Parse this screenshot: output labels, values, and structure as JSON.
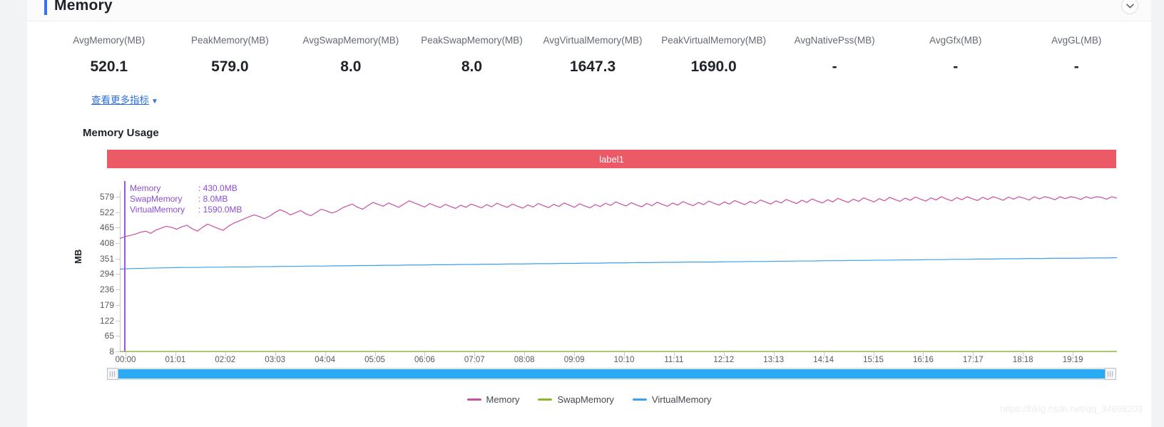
{
  "panel": {
    "title": "Memory",
    "collapse_icon": "chevron-down-icon"
  },
  "metrics": [
    {
      "label": "AvgMemory(MB)",
      "value": "520.1"
    },
    {
      "label": "PeakMemory(MB)",
      "value": "579.0"
    },
    {
      "label": "AvgSwapMemory(MB)",
      "value": "8.0"
    },
    {
      "label": "PeakSwapMemory(MB)",
      "value": "8.0"
    },
    {
      "label": "AvgVirtualMemory(MB)",
      "value": "1647.3"
    },
    {
      "label": "PeakVirtualMemory(MB)",
      "value": "1690.0"
    },
    {
      "label": "AvgNativePss(MB)",
      "value": "-"
    },
    {
      "label": "AvgGfx(MB)",
      "value": "-"
    },
    {
      "label": "AvgGL(MB)",
      "value": "-"
    }
  ],
  "more_link": {
    "label": "查看更多指标",
    "caret": "▼"
  },
  "chart_section": {
    "heading": "Memory Usage",
    "label_bar": {
      "text": "label1",
      "color": "#ec5a68"
    }
  },
  "tooltip": {
    "rows": [
      {
        "key": "Memory",
        "value": ": 430.0MB"
      },
      {
        "key": "SwapMemory",
        "value": ": 8.0MB"
      },
      {
        "key": "VirtualMemory",
        "value": ": 1590.0MB"
      }
    ],
    "color": "#8a4fd0"
  },
  "datazoom": {
    "left_handle_glyph": "|||",
    "right_handle_glyph": "|||",
    "fill_color": "#2cabf5"
  },
  "watermark": "https://blog.csdn.net/qq_34696203",
  "chart_data": {
    "type": "line",
    "title": "Memory Usage",
    "xlabel": "",
    "ylabel": "MB",
    "grid": false,
    "legend_position": "bottom",
    "ylim": [
      8,
      600
    ],
    "yticks": [
      579,
      522,
      465,
      408,
      351,
      294,
      236,
      179,
      122,
      65,
      8
    ],
    "x": [
      "00:00",
      "01:01",
      "02:02",
      "03:03",
      "04:04",
      "05:05",
      "06:06",
      "07:07",
      "08:08",
      "09:09",
      "10:10",
      "11:11",
      "12:12",
      "13:13",
      "14:14",
      "15:15",
      "16:16",
      "17:17",
      "18:18",
      "19:19"
    ],
    "xticks": [
      "00:00",
      "01:01",
      "02:02",
      "03:03",
      "04:04",
      "05:05",
      "06:06",
      "07:07",
      "08:08",
      "09:09",
      "10:10",
      "11:11",
      "12:12",
      "13:13",
      "14:14",
      "15:15",
      "16:16",
      "17:17",
      "18:18",
      "19:19"
    ],
    "series": [
      {
        "name": "Memory",
        "color": "#c94fa0",
        "unit": "MB",
        "values": [
          425,
          432,
          436,
          441,
          448,
          452,
          444,
          456,
          463,
          470,
          466,
          459,
          468,
          474,
          461,
          452,
          466,
          478,
          470,
          462,
          455,
          470,
          481,
          489,
          497,
          505,
          512,
          506,
          498,
          508,
          520,
          531,
          524,
          512,
          520,
          528,
          516,
          509,
          521,
          533,
          527,
          519,
          525,
          537,
          545,
          552,
          540,
          533,
          546,
          558,
          551,
          544,
          556,
          548,
          540,
          552,
          564,
          556,
          549,
          541,
          554,
          546,
          539,
          551,
          543,
          536,
          548,
          540,
          552,
          545,
          538,
          550,
          542,
          555,
          547,
          540,
          552,
          544,
          537,
          549,
          541,
          554,
          546,
          539,
          551,
          543,
          556,
          548,
          540,
          553,
          545,
          538,
          550,
          543,
          555,
          547,
          560,
          552,
          545,
          557,
          549,
          542,
          554,
          546,
          559,
          551,
          544,
          556,
          548,
          561,
          553,
          546,
          558,
          550,
          563,
          555,
          548,
          560,
          552,
          565,
          557,
          550,
          562,
          554,
          567,
          559,
          552,
          564,
          556,
          569,
          561,
          554,
          566,
          558,
          571,
          563,
          556,
          568,
          560,
          573,
          565,
          558,
          570,
          562,
          575,
          567,
          560,
          572,
          564,
          577,
          569,
          562,
          574,
          566,
          578,
          570,
          563,
          575,
          567,
          579,
          571,
          564,
          576,
          568,
          579,
          572,
          565,
          577,
          569,
          579,
          573,
          566,
          578,
          570,
          579,
          574,
          567,
          579,
          571,
          579,
          575,
          568,
          579,
          572,
          579,
          576,
          569,
          579,
          573,
          579,
          577,
          570,
          579,
          574
        ]
      },
      {
        "name": "SwapMemory",
        "color": "#8cb82b",
        "unit": "MB",
        "values": [
          8,
          8,
          8,
          8,
          8,
          8,
          8,
          8,
          8,
          8,
          8,
          8,
          8,
          8,
          8,
          8,
          8,
          8,
          8,
          8
        ]
      },
      {
        "name": "VirtualMemory",
        "color": "#3ba0f0",
        "unit": "MB",
        "values": [
          312,
          314,
          315,
          316,
          317,
          318,
          318,
          319,
          319,
          320,
          320,
          321,
          321,
          322,
          322,
          323,
          323,
          324,
          324,
          325,
          325,
          326,
          326,
          327,
          327,
          328,
          328,
          329,
          329,
          330,
          330,
          331,
          331,
          332,
          332,
          333,
          333,
          334,
          334,
          335,
          335,
          336,
          336,
          337,
          337,
          338,
          338,
          338,
          339,
          339,
          340,
          340,
          341,
          341,
          342,
          342,
          343,
          343,
          344,
          344,
          345,
          345,
          346,
          346,
          347,
          347,
          348,
          348,
          349,
          349,
          350,
          350,
          351,
          351,
          352,
          352,
          352,
          353,
          353,
          354
        ]
      }
    ],
    "legend": [
      {
        "name": "Memory",
        "color": "#c94fa0"
      },
      {
        "name": "SwapMemory",
        "color": "#8cb82b"
      },
      {
        "name": "VirtualMemory",
        "color": "#3ba0f0"
      }
    ],
    "marker": {
      "x": "00:05",
      "color": "#9b59d0"
    }
  }
}
